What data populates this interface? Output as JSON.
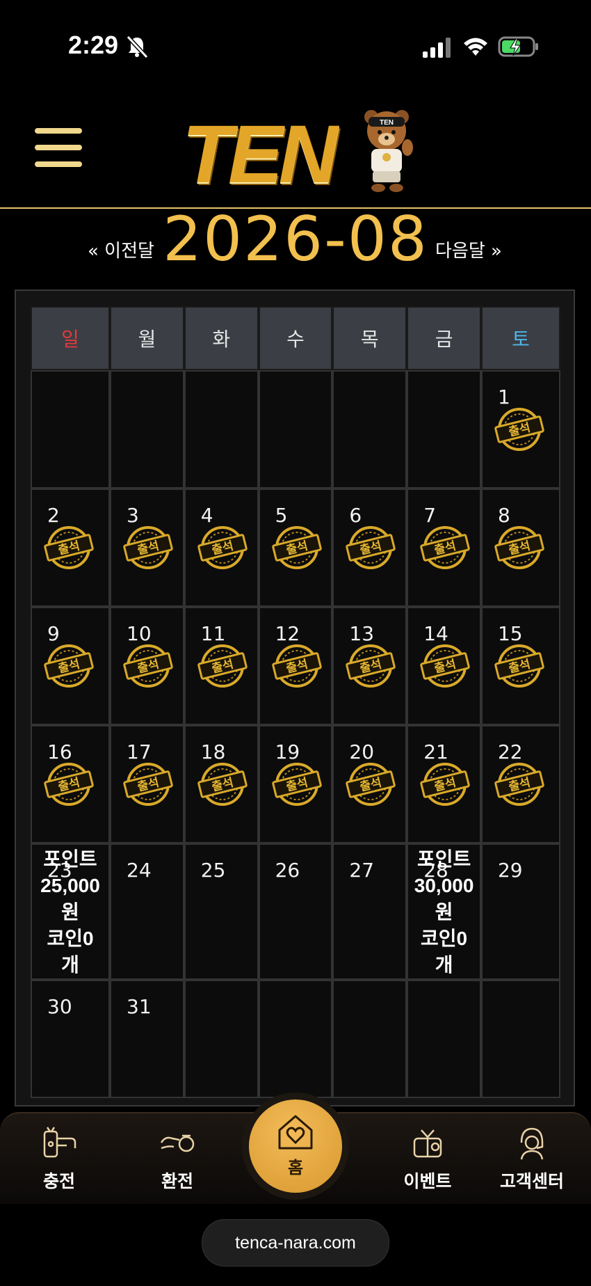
{
  "status_bar": {
    "time": "2:29"
  },
  "header": {
    "logo_text": "TEN"
  },
  "month_nav": {
    "prev_label": "« 이전달",
    "current": "2026-08",
    "next_label": "다음달 »"
  },
  "calendar": {
    "weekdays": [
      "일",
      "월",
      "화",
      "수",
      "목",
      "금",
      "토"
    ],
    "weeks": [
      [
        {
          "day": "",
          "stamp": false
        },
        {
          "day": "",
          "stamp": false
        },
        {
          "day": "",
          "stamp": false
        },
        {
          "day": "",
          "stamp": false
        },
        {
          "day": "",
          "stamp": false
        },
        {
          "day": "",
          "stamp": false
        },
        {
          "day": "1",
          "stamp": true
        }
      ],
      [
        {
          "day": "2",
          "stamp": true
        },
        {
          "day": "3",
          "stamp": true
        },
        {
          "day": "4",
          "stamp": true
        },
        {
          "day": "5",
          "stamp": true
        },
        {
          "day": "6",
          "stamp": true
        },
        {
          "day": "7",
          "stamp": true
        },
        {
          "day": "8",
          "stamp": true
        }
      ],
      [
        {
          "day": "9",
          "stamp": true
        },
        {
          "day": "10",
          "stamp": true
        },
        {
          "day": "11",
          "stamp": true
        },
        {
          "day": "12",
          "stamp": true
        },
        {
          "day": "13",
          "stamp": true
        },
        {
          "day": "14",
          "stamp": true
        },
        {
          "day": "15",
          "stamp": true
        }
      ],
      [
        {
          "day": "16",
          "stamp": true
        },
        {
          "day": "17",
          "stamp": true
        },
        {
          "day": "18",
          "stamp": true
        },
        {
          "day": "19",
          "stamp": true
        },
        {
          "day": "20",
          "stamp": true
        },
        {
          "day": "21",
          "stamp": true
        },
        {
          "day": "22",
          "stamp": true
        }
      ],
      [
        {
          "day": "23",
          "stamp": false,
          "reward": [
            "포인트",
            "25,000",
            "원",
            "코인0",
            "개"
          ]
        },
        {
          "day": "24",
          "stamp": false
        },
        {
          "day": "25",
          "stamp": false
        },
        {
          "day": "26",
          "stamp": false
        },
        {
          "day": "27",
          "stamp": false
        },
        {
          "day": "28",
          "stamp": false,
          "reward": [
            "포인트",
            "30,000",
            "원",
            "코인0",
            "개"
          ]
        },
        {
          "day": "29",
          "stamp": false
        }
      ],
      [
        {
          "day": "30",
          "stamp": false
        },
        {
          "day": "31",
          "stamp": false
        },
        {
          "day": "",
          "stamp": false
        },
        {
          "day": "",
          "stamp": false
        },
        {
          "day": "",
          "stamp": false
        },
        {
          "day": "",
          "stamp": false
        },
        {
          "day": "",
          "stamp": false
        }
      ]
    ],
    "stamp_text": "출석"
  },
  "bottom_nav": {
    "charge": "충전",
    "exchange": "환전",
    "home": "홈",
    "event": "이벤트",
    "support": "고객센터"
  },
  "url": "tenca-nara.com",
  "colors": {
    "gold": "#f2c04e",
    "sunday": "#e23b3b",
    "saturday": "#4fb6e8"
  }
}
